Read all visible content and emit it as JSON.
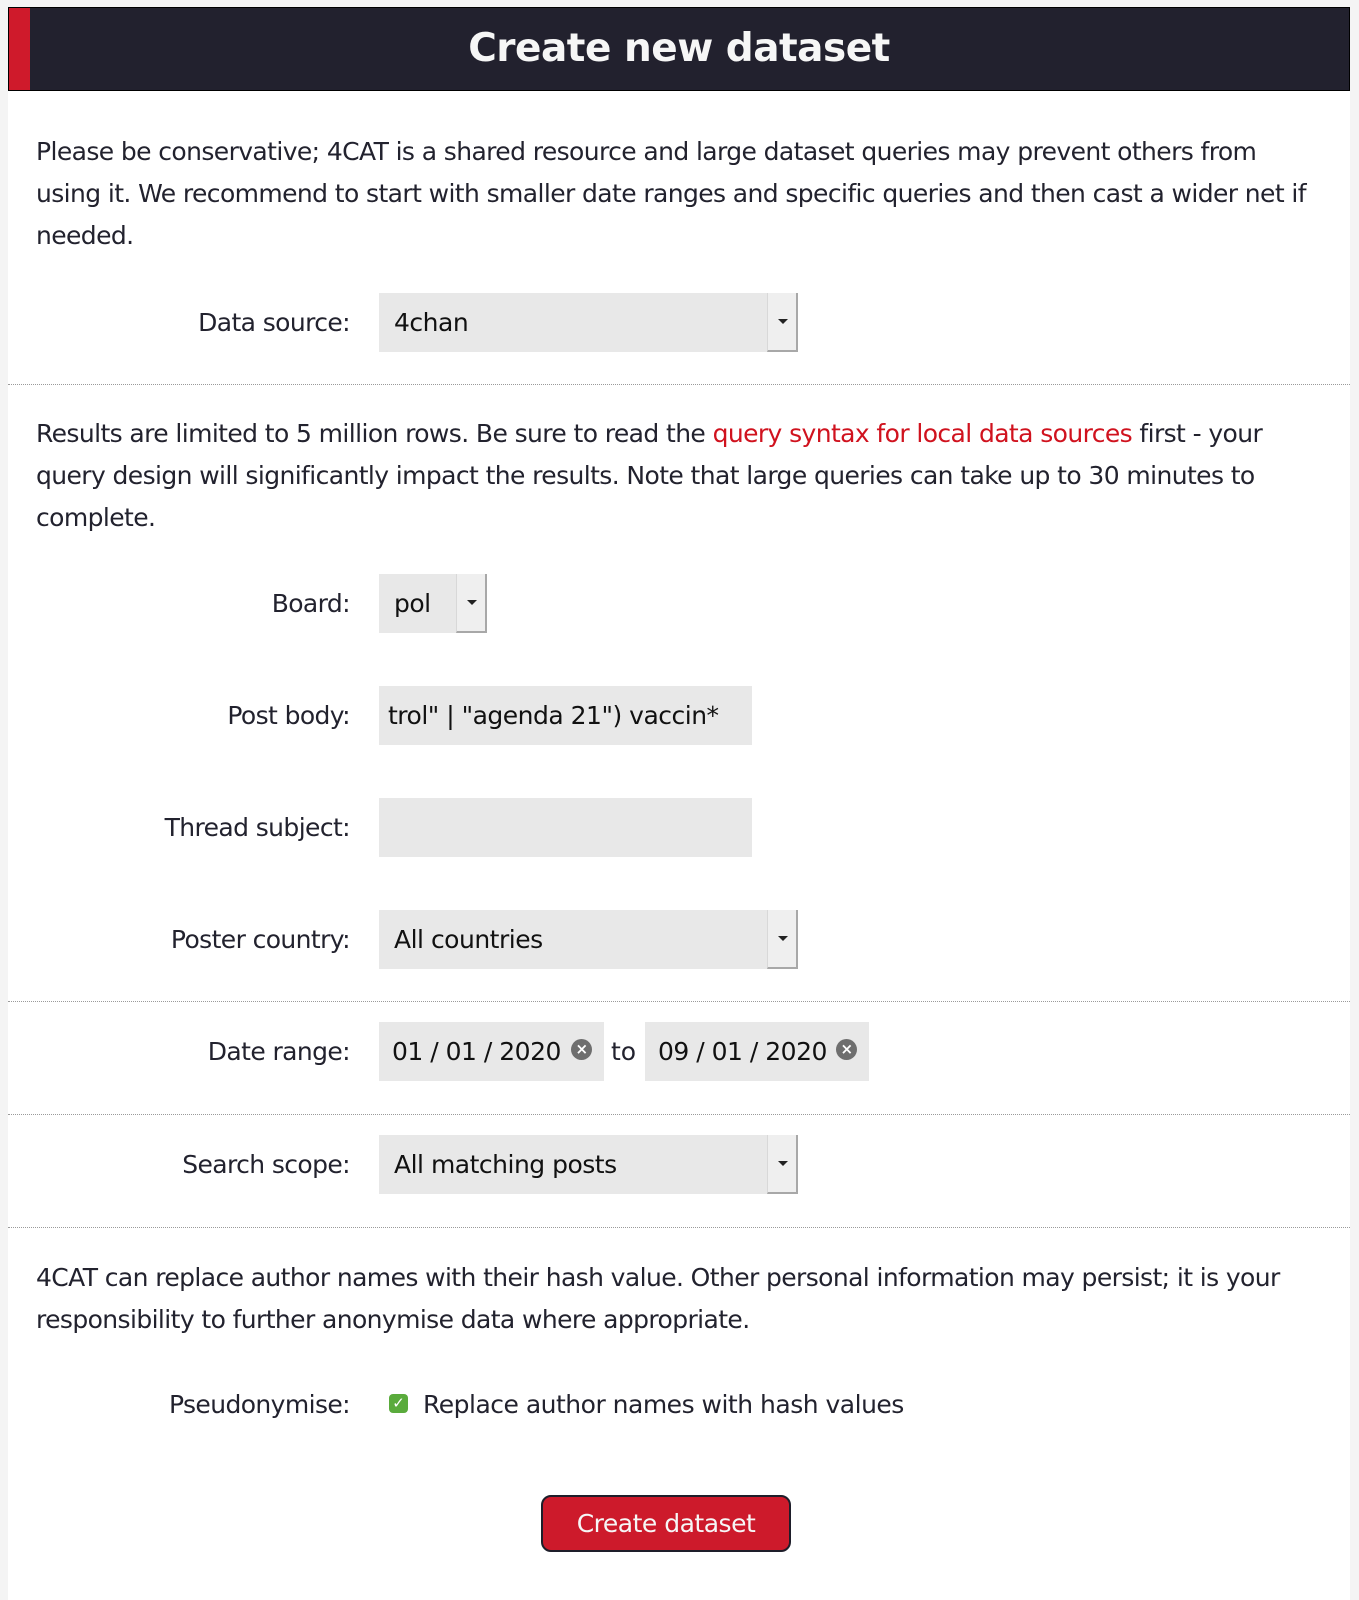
{
  "header": {
    "title": "Create new dataset"
  },
  "intro_text": "Please be conservative; 4CAT is a shared resource and large dataset queries may prevent others from using it. We recommend to start with smaller date ranges and specific queries and then cast a wider net if needed.",
  "data_source": {
    "label": "Data source:",
    "value": "4chan"
  },
  "results_note": {
    "before_link": "Results are limited to 5 million rows. Be sure to read the ",
    "link_text": "query syntax for local data sources",
    "after_link": " first - your query design will significantly impact the results. Note that large queries can take up to 30 minutes to complete."
  },
  "board": {
    "label": "Board:",
    "value": "pol"
  },
  "post_body": {
    "label": "Post body:",
    "value": "trol\" | \"agenda 21\") vaccin*"
  },
  "thread_subject": {
    "label": "Thread subject:",
    "value": ""
  },
  "poster_country": {
    "label": "Poster country:",
    "value": "All countries"
  },
  "date_range": {
    "label": "Date range:",
    "from": "01 / 01 / 2020",
    "separator": "to",
    "to": "09 / 01 / 2020",
    "clear_icon": "×"
  },
  "search_scope": {
    "label": "Search scope:",
    "value": "All matching posts"
  },
  "pseudonymise_note": "4CAT can replace author names with their hash value. Other personal information may persist; it is your responsibility to further anonymise data where appropriate.",
  "pseudonymise": {
    "label": "Pseudonymise:",
    "checkbox_label": "Replace author names with hash values",
    "checked": true,
    "check_glyph": "✓"
  },
  "submit": {
    "label": "Create dataset"
  },
  "colors": {
    "accent": "#cf1a2b",
    "header_bg": "#22212e",
    "link": "#d0121e",
    "checkbox": "#5aab3c"
  }
}
